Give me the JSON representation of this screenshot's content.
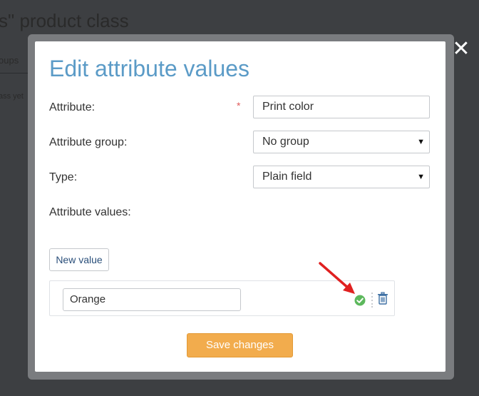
{
  "background": {
    "page_title": "s\" product class",
    "tab_fragment": "oups",
    "note_fragment": "ass yet"
  },
  "modal": {
    "title": "Edit attribute values",
    "close_label": "✕",
    "fields": {
      "attribute": {
        "label": "Attribute:",
        "required_mark": "*",
        "value": "Print color"
      },
      "attribute_group": {
        "label": "Attribute group:",
        "selected": "No group"
      },
      "type": {
        "label": "Type:",
        "selected": "Plain field"
      },
      "attribute_values": {
        "label": "Attribute values:"
      }
    },
    "new_value_label": "New value",
    "values": [
      {
        "value": "Orange"
      }
    ],
    "save_label": "Save changes"
  },
  "colors": {
    "title_blue": "#5b9bc7",
    "save_orange": "#f2ac4d",
    "check_green": "#5cb85c",
    "annotation_red": "#e02020"
  },
  "icons": [
    "close-icon",
    "chevron-down-icon",
    "check-circle-icon",
    "trash-icon",
    "annotation-arrow"
  ]
}
